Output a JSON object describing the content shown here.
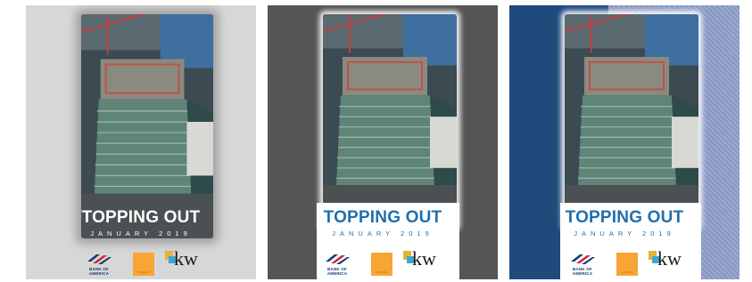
{
  "panels": [
    {
      "title": "TOPPING OUT",
      "subtitle": "JANUARY 2019",
      "background": "#d7d7d7"
    },
    {
      "title": "TOPPING OUT",
      "subtitle": "JANUARY 2019",
      "background": "#555555"
    },
    {
      "title": "TOPPING OUT",
      "subtitle": "JANUARY 2019",
      "background": "#1f4a7c"
    }
  ],
  "logos": {
    "boa": "BANK OF AMERICA",
    "orange": "CARSON",
    "kw": "kw"
  },
  "colors": {
    "title_blue": "#1f6fb0",
    "orange_logo": "#f7a535",
    "boa_navy": "#0b3a74",
    "boa_red": "#d21f2f"
  }
}
